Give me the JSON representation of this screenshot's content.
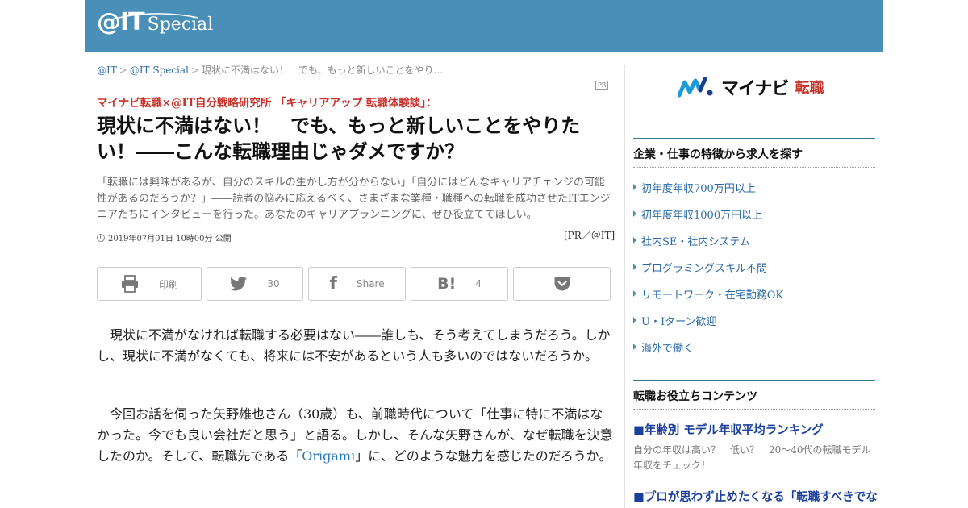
{
  "header": {
    "logo_at": "@IT",
    "logo_special": "Special"
  },
  "breadcrumb": {
    "items": [
      "@IT",
      "@IT Special"
    ],
    "current": "現状に不満はない！　でも、もっと新しいことをやり..."
  },
  "article": {
    "pr_badge": "PR",
    "series": "マイナビ転職×@IT自分戦略研究所 「キャリアアップ 転職体験談」：",
    "title": "現状に不満はない！　でも、もっと新しいことをやりたい！――こんな転職理由じゃダメですか？",
    "lead": "「転職には興味があるが、自分のスキルの生かし方が分からない」「自分にはどんなキャリアチェンジの可能性があるのだろうか？」――読者の悩みに応えるべく、さまざまな業種・職種への転職を成功させたITエンジニアたちにインタビューを行った。あなたのキャリアプランニングに、ぜひ役立ててほしい。",
    "date": "2019年07月01日 10時00分 公開",
    "credit": "[PR／＠IT]",
    "share": {
      "print_label": "印刷",
      "twitter_count": "30",
      "facebook_label": "Share",
      "hatena_count": "4"
    },
    "p1": "　現状に不満がなければ転職する必要はない――誰しも、そう考えてしまうだろう。しかし、現状に不満がなくても、将来には不安があるという人も多いのではないだろうか。",
    "p2_before": "　今回お話を伺った矢野雄也さん（30歳）も、前職時代について「仕事に特に不満はなかった。今でも良い会社だと思う」と語る。しかし、そんな矢野さんが、なぜ転職を決意したのか。そして、転職先である「",
    "p2_link": "Origami",
    "p2_after": "」に、どのような魅力を感じたのだろうか。"
  },
  "sidebar": {
    "brand_name": "マイナビ",
    "brand_job": "転職",
    "section1_title": "企業・仕事の特徴から求人を探す",
    "links": [
      "初年度年収700万円以上",
      "初年度年収1000万円以上",
      "社内SE・社内システム",
      "プログラミングスキル不問",
      "リモートワーク・在宅勤務OK",
      "U・Iターン歓迎",
      "海外で働く"
    ],
    "section2_title": "転職お役立ちコンテンツ",
    "features": [
      {
        "title": "■年齢別 モデル年収平均ランキング",
        "desc": "自分の年収は高い？　低い？　20～40代の転職モデル年収をチェック！"
      },
      {
        "title": "■プロが思わず止めたくなる「転職すべきでな"
      }
    ],
    "colors": {
      "accent": "#4a8fb8",
      "brand_red": "#c8322a",
      "link": "#2a6aa8"
    }
  }
}
